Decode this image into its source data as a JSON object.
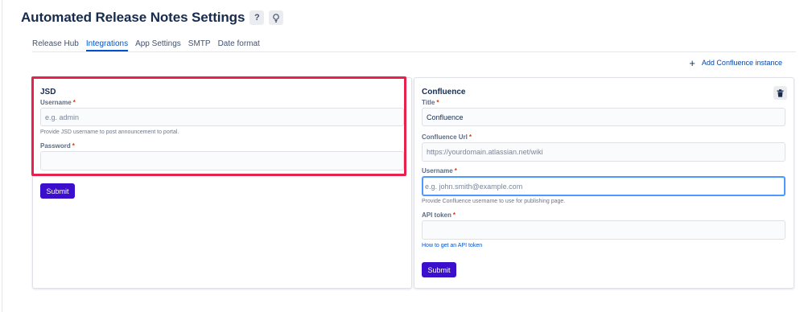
{
  "header": {
    "title": "Automated Release Notes Settings",
    "help_button_label": "?",
    "tip_icon": "lightbulb-icon"
  },
  "tabs": [
    {
      "label": "Release Hub",
      "active": false
    },
    {
      "label": "Integrations",
      "active": true
    },
    {
      "label": "App Settings",
      "active": false
    },
    {
      "label": "SMTP",
      "active": false
    },
    {
      "label": "Date format",
      "active": false
    }
  ],
  "add_confluence": {
    "icon": "+",
    "label": "Add Confluence instance"
  },
  "jsd": {
    "title": "JSD",
    "username": {
      "label": "Username",
      "required": "*",
      "value": "",
      "placeholder": "e.g. admin"
    },
    "username_help": "Provide JSD username to post announcement to portal.",
    "password": {
      "label": "Password",
      "required": "*",
      "value": ""
    },
    "submit_label": "Submit"
  },
  "confluence": {
    "title": "Confluence",
    "delete_icon": "trash-icon",
    "title_field": {
      "label": "Title",
      "required": "*",
      "value": "Confluence"
    },
    "url": {
      "label": "Confluence Url",
      "required": "*",
      "value": "",
      "placeholder": "https://yourdomain.atlassian.net/wiki"
    },
    "username": {
      "label": "Username",
      "required": "*",
      "value": "",
      "placeholder": "e.g. john.smith@example.com"
    },
    "username_help": "Provide Confluence username to use for publishing page.",
    "api_token": {
      "label": "API token",
      "required": "*",
      "value": ""
    },
    "api_token_link": "How to get an API token",
    "submit_label": "Submit"
  },
  "colors": {
    "accent": "#0052cc",
    "primary_button": "#3c0fcc",
    "highlight": "#e8204d",
    "required": "#de350b"
  }
}
